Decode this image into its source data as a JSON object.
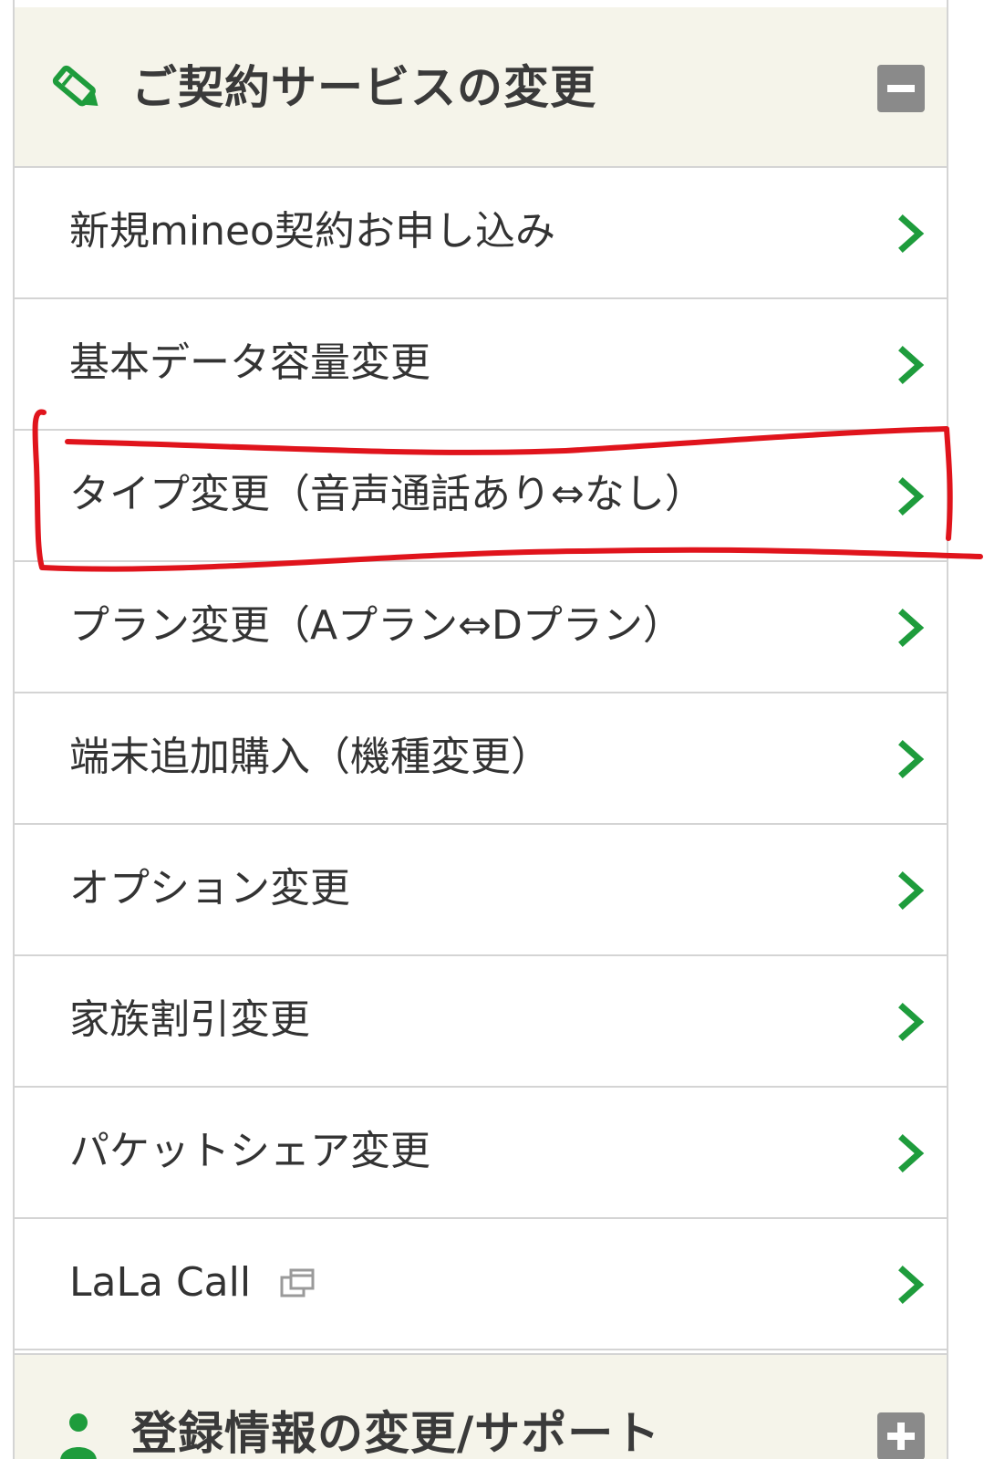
{
  "section1": {
    "title": "ご契約サービスの変更",
    "icon": "pencil-icon",
    "toggle_icon": "minus-icon"
  },
  "menu": {
    "items": [
      {
        "label": "新規mineo契約お申し込み"
      },
      {
        "label": "基本データ容量変更"
      },
      {
        "label": "タイプ変更（音声通話あり⇔なし）"
      },
      {
        "label": "プラン変更（Aプラン⇔Dプラン）"
      },
      {
        "label": "端末追加購入（機種変更）"
      },
      {
        "label": "オプション変更"
      },
      {
        "label": "家族割引変更"
      },
      {
        "label": "パケットシェア変更"
      },
      {
        "label": "LaLa Call"
      }
    ]
  },
  "section2": {
    "title": "登録情報の変更/サポート",
    "icon": "person-icon",
    "toggle_icon": "plus-icon"
  },
  "colors": {
    "accent_green": "#1e9c3c",
    "header_bg": "#f5f4ea",
    "annotation_red": "#e0141c",
    "toggle_gray": "#8a8a8a"
  }
}
